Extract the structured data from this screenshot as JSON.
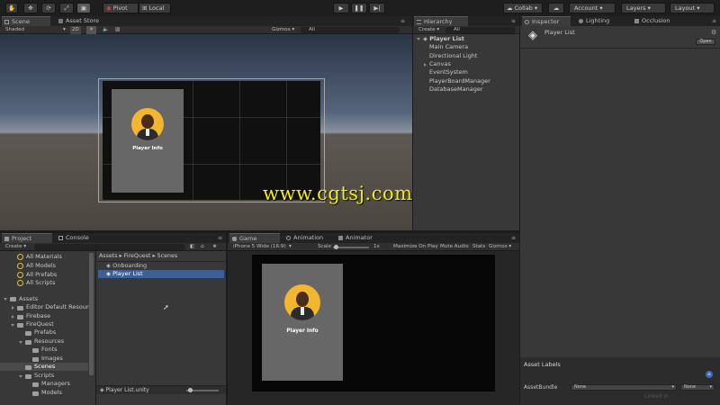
{
  "toolbar": {
    "pivot_label": "Pivot",
    "local_label": "Local",
    "collab_label": "Collab",
    "account_label": "Account",
    "layers_label": "Layers",
    "layout_label": "Layout"
  },
  "scene": {
    "tabs": [
      {
        "label": "Scene"
      },
      {
        "label": "Asset Store"
      }
    ],
    "shading_mode": "Shaded",
    "mode_2d": "2D",
    "gizmos_label": "Gizmos",
    "search_all_label": "All",
    "card_label": "Player Info"
  },
  "hierarchy": {
    "tab_label": "Hierarchy",
    "create_label": "Create",
    "search_all_label": "All",
    "root": "Player List",
    "items": [
      {
        "label": "Main Camera"
      },
      {
        "label": "Directional Light"
      },
      {
        "label": "Canvas"
      },
      {
        "label": "EventSystem"
      },
      {
        "label": "PlayerBoardManager"
      },
      {
        "label": "DatabaseManager"
      }
    ]
  },
  "inspector": {
    "tabs": [
      {
        "label": "Inspector"
      },
      {
        "label": "Lighting"
      },
      {
        "label": "Occlusion"
      }
    ],
    "object_name": "Player List",
    "open_label": "Open",
    "asset_labels_heading": "Asset Labels",
    "asset_bundle_label": "AssetBundle",
    "asset_bundle_value": "None",
    "asset_variant_value": "None"
  },
  "project": {
    "tabs": [
      {
        "label": "Project"
      },
      {
        "label": "Console"
      }
    ],
    "create_label": "Create",
    "favorites": [
      {
        "label": "All Materials"
      },
      {
        "label": "All Models"
      },
      {
        "label": "All Prefabs"
      },
      {
        "label": "All Scripts"
      }
    ],
    "assets_root": "Assets",
    "tree": [
      {
        "label": "Editor Default Resources"
      },
      {
        "label": "Firebase"
      },
      {
        "label": "FireQuest"
      },
      {
        "label": "Prefabs"
      },
      {
        "label": "Resources"
      },
      {
        "label": "Fonts"
      },
      {
        "label": "Images"
      },
      {
        "label": "Scenes"
      },
      {
        "label": "Scripts"
      },
      {
        "label": "Managers"
      },
      {
        "label": "Models"
      }
    ],
    "breadcrumb": [
      "Assets",
      "FireQuest",
      "Scenes"
    ],
    "files": [
      {
        "label": "Onboarding"
      },
      {
        "label": "Player List"
      }
    ],
    "footer_file": "Player List.unity"
  },
  "game": {
    "tabs": [
      {
        "label": "Game"
      },
      {
        "label": "Animation"
      },
      {
        "label": "Animator"
      }
    ],
    "resolution": "iPhone 5 Wide (16:9)",
    "scale_label": "Scale",
    "scale_value": "1x",
    "maximize_label": "Maximize On Play",
    "mute_label": "Mute Audio",
    "stats_label": "Stats",
    "gizmos_label": "Gizmos",
    "card_label": "Player Info"
  },
  "watermark": "www.cgtsj.com",
  "corner_watermark": "Linked in",
  "colors": {
    "selection": "#3e5f96",
    "avatar_ring": "#f2b630",
    "watermark": "#f4f000"
  }
}
